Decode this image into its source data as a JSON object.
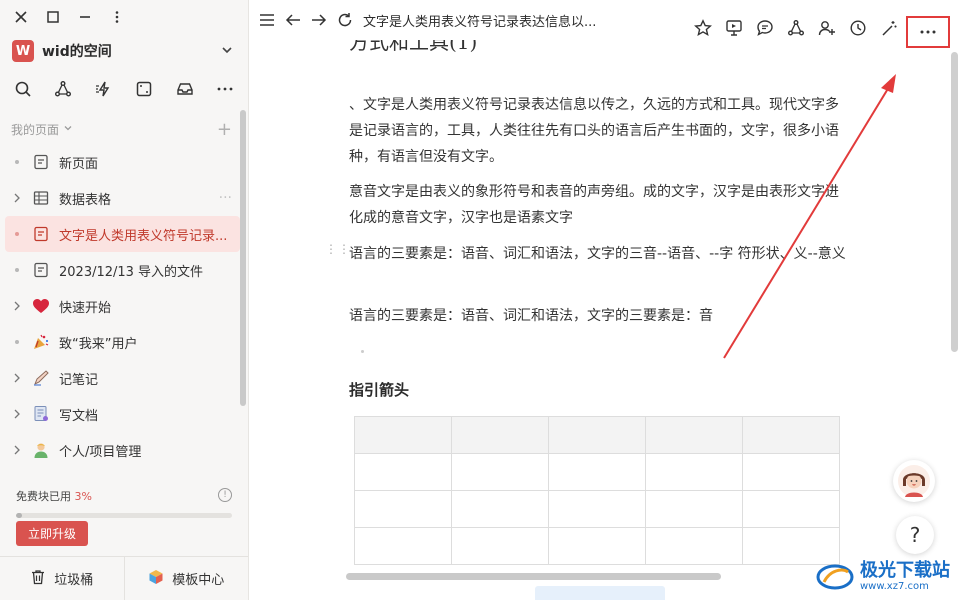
{
  "sidebar": {
    "space_initial": "W",
    "space_name": "wid的空间",
    "section_title": "我的页面",
    "items": [
      {
        "label": "新页面",
        "icon": "page-icon",
        "expandable": false
      },
      {
        "label": "数据表格",
        "icon": "table-icon",
        "expandable": true
      },
      {
        "label": "文字是人类用表义符号记录...",
        "icon": "page-icon",
        "expandable": false,
        "active": true
      },
      {
        "label": "2023/12/13 导入的文件",
        "icon": "page-icon",
        "expandable": false
      },
      {
        "label": "快速开始",
        "icon": "heart-icon",
        "expandable": true
      },
      {
        "label": "致“我来”用户",
        "icon": "party-icon",
        "expandable": false
      },
      {
        "label": "记笔记",
        "icon": "pen-icon",
        "expandable": true
      },
      {
        "label": "写文档",
        "icon": "document-icon",
        "expandable": true
      },
      {
        "label": "个人/项目管理",
        "icon": "person-icon",
        "expandable": true
      }
    ],
    "usage_label": "免费块已用",
    "usage_pct": "3%",
    "usage_fraction": 0.03,
    "upgrade_label": "立即升级",
    "trash_label": "垃圾桶",
    "templates_label": "模板中心"
  },
  "topbar": {
    "doc_title": "文字是人类用表义符号记录表达信息以..."
  },
  "content": {
    "heading_partial": "方式和工具(1)",
    "para1": "、文字是人类用表义符号记录表达信息以传之，久远的方式和工具。现代文字多是记录语言的，工具，人类往往先有口头的语言后产生书面的，文字，很多小语种，有语言但没有文字。",
    "para2": "意音文字是由表义的象形符号和表音的声旁组。成的文字，汉字是由表形文字进化成的意音文字，汉字也是语素文字",
    "para3": "语言的三要素是：语音、词汇和语法，文字的三音--语音、--字 符形状、义--意义",
    "para4": "语言的三要素是：语音、词汇和语法，文字的三要素是：音",
    "subheading": "指引箭头"
  },
  "colors": {
    "accent": "#d9534f",
    "highlight_box": "#e23b3b",
    "sidebar_bg": "#f7f6f5",
    "active_bg": "#fbe3e1"
  },
  "watermark": {
    "name": "极光下载站",
    "url": "www.xz7.com"
  }
}
